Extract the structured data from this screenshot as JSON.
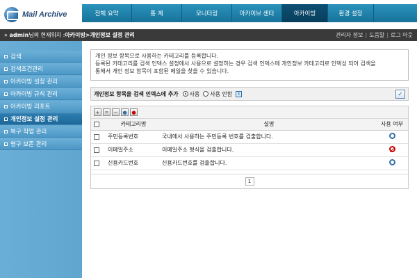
{
  "logo": {
    "text": "Mail Archive"
  },
  "topnav": {
    "tabs": [
      {
        "label": "전체 요약",
        "active": false
      },
      {
        "label": "통 계",
        "active": false
      },
      {
        "label": "모니터링",
        "active": false
      },
      {
        "label": "아카이브 센터",
        "active": false
      },
      {
        "label": "아카이빙",
        "active": true
      },
      {
        "label": "환경 설정",
        "active": false
      }
    ]
  },
  "breadcrumb": {
    "user": "admin",
    "suffix": "님의 현재위치 : ",
    "path1": "아카이빙",
    "separator": " > ",
    "path2": "개인정보 설정 관리",
    "links": [
      "관리자 정보",
      "도움말",
      "로그 아웃"
    ]
  },
  "sidebar": {
    "items": [
      {
        "label": "검색",
        "active": false
      },
      {
        "label": "검색조건관리",
        "active": false
      },
      {
        "label": "아카이빙 설정 관리",
        "active": false
      },
      {
        "label": "아카이빙 규칙 관리",
        "active": false
      },
      {
        "label": "아카이빙 리포트",
        "active": false
      },
      {
        "label": "개인정보 설정 관리",
        "active": true
      },
      {
        "label": "복구 작업 관리",
        "active": false
      },
      {
        "label": "영구 보존 관리",
        "active": false
      }
    ]
  },
  "description": {
    "line1": "개인 정보 항목으로 사용하는 카테고리를 등록합니다.",
    "line2": "등록된 카테고리를 검색 인덱스 설정에서 사용으로 설정하는 경우 검색 인덱스에 개인정보 카테고리로 인덱싱 되어 검색을",
    "line3": "통해서 개인 정보 항목이 포함된 메일을 찾을 수 있습니다."
  },
  "index_option": {
    "label": "개인정보 항목을 검색 인덱스에 추가",
    "opt_use": "사용",
    "opt_nouse": "사용 안함",
    "selected": "사용",
    "info_icon": "i",
    "confirm_icon": "✓"
  },
  "table": {
    "headers": {
      "category": "카테고리명",
      "description": "설명",
      "usage": "사용 여부"
    },
    "rows": [
      {
        "category": "주민등록번호",
        "description": "국내에서 사용하는 주민등록 번호를 검출합니다.",
        "usage": "enabled"
      },
      {
        "category": "이메일주소",
        "description": "이메일주소 형식을 검출합니다.",
        "usage": "disabled"
      },
      {
        "category": "신용카드번호",
        "description": "신용카드번호를 검출합니다.",
        "usage": "enabled"
      }
    ]
  },
  "pager": {
    "current": "1"
  },
  "colors": {
    "nav_bg": "#1f7fa6",
    "nav_active": "#0d4f73",
    "sidebar_bg": "#5fa6d0",
    "bc_bg": "#3a3a3a",
    "enabled": "#2f6fa8",
    "disabled": "#cc0000"
  }
}
